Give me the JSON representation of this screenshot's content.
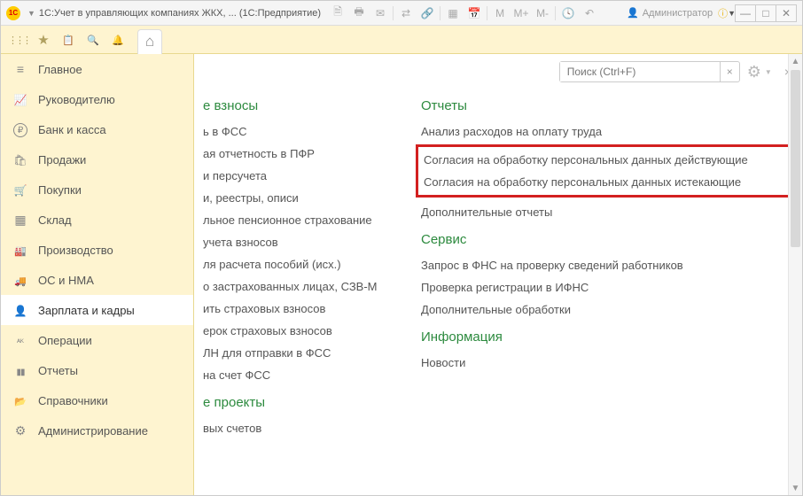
{
  "titlebar": {
    "logo_text": "1C",
    "title": "1С:Учет в управляющих компаниях ЖКХ, ... (1С:Предприятие)",
    "icons": [
      "file",
      "print",
      "mail",
      "compare",
      "copy",
      "calendar",
      "table",
      "M",
      "M+",
      "M-",
      "clock",
      "back"
    ],
    "user_label": "Администратор"
  },
  "search": {
    "placeholder": "Поиск (Ctrl+F)"
  },
  "sidebar": [
    {
      "icon": "i-lines",
      "label": "Главное"
    },
    {
      "icon": "i-chart",
      "label": "Руководителю"
    },
    {
      "icon": "i-ruble",
      "label": "Банк и касса"
    },
    {
      "icon": "i-bag",
      "label": "Продажи"
    },
    {
      "icon": "i-cart",
      "label": "Покупки"
    },
    {
      "icon": "i-box",
      "label": "Склад"
    },
    {
      "icon": "i-factory",
      "label": "Производство"
    },
    {
      "icon": "i-truck",
      "label": "ОС и НМА"
    },
    {
      "icon": "i-person",
      "label": "Зарплата и кадры"
    },
    {
      "icon": "i-ops",
      "label": "Операции"
    },
    {
      "icon": "i-bars",
      "label": "Отчеты"
    },
    {
      "icon": "i-book",
      "label": "Справочники"
    },
    {
      "icon": "i-gear",
      "label": "Администрирование"
    }
  ],
  "left_column": {
    "heading": "е взносы",
    "items": [
      "ь в ФСС",
      "ая отчетность в ПФР",
      "и персучета",
      "и, реестры, описи",
      "льное пенсионное страхование",
      "учета взносов",
      "ля расчета пособий (исх.)",
      "о застрахованных лицах, СЗВ-М",
      "ить страховых взносов",
      "ерок страховых взносов",
      "ЛН для отправки в ФСС",
      "на счет ФСС"
    ],
    "heading2": "е проекты",
    "items2": [
      "вых счетов"
    ]
  },
  "right_column": {
    "sections": [
      {
        "title": "Отчеты",
        "items": [
          {
            "text": "Анализ расходов на оплату труда",
            "hl": false
          },
          {
            "text": "Согласия на обработку персональных данных действующие",
            "hl": true
          },
          {
            "text": "Согласия на обработку персональных данных истекающие",
            "hl": true
          },
          {
            "text": "Дополнительные отчеты",
            "hl": false
          }
        ]
      },
      {
        "title": "Сервис",
        "items": [
          {
            "text": "Запрос в ФНС на проверку сведений работников"
          },
          {
            "text": "Проверка регистрации в ИФНС"
          },
          {
            "text": "Дополнительные обработки"
          }
        ]
      },
      {
        "title": "Информация",
        "items": [
          {
            "text": "Новости"
          }
        ]
      }
    ]
  }
}
